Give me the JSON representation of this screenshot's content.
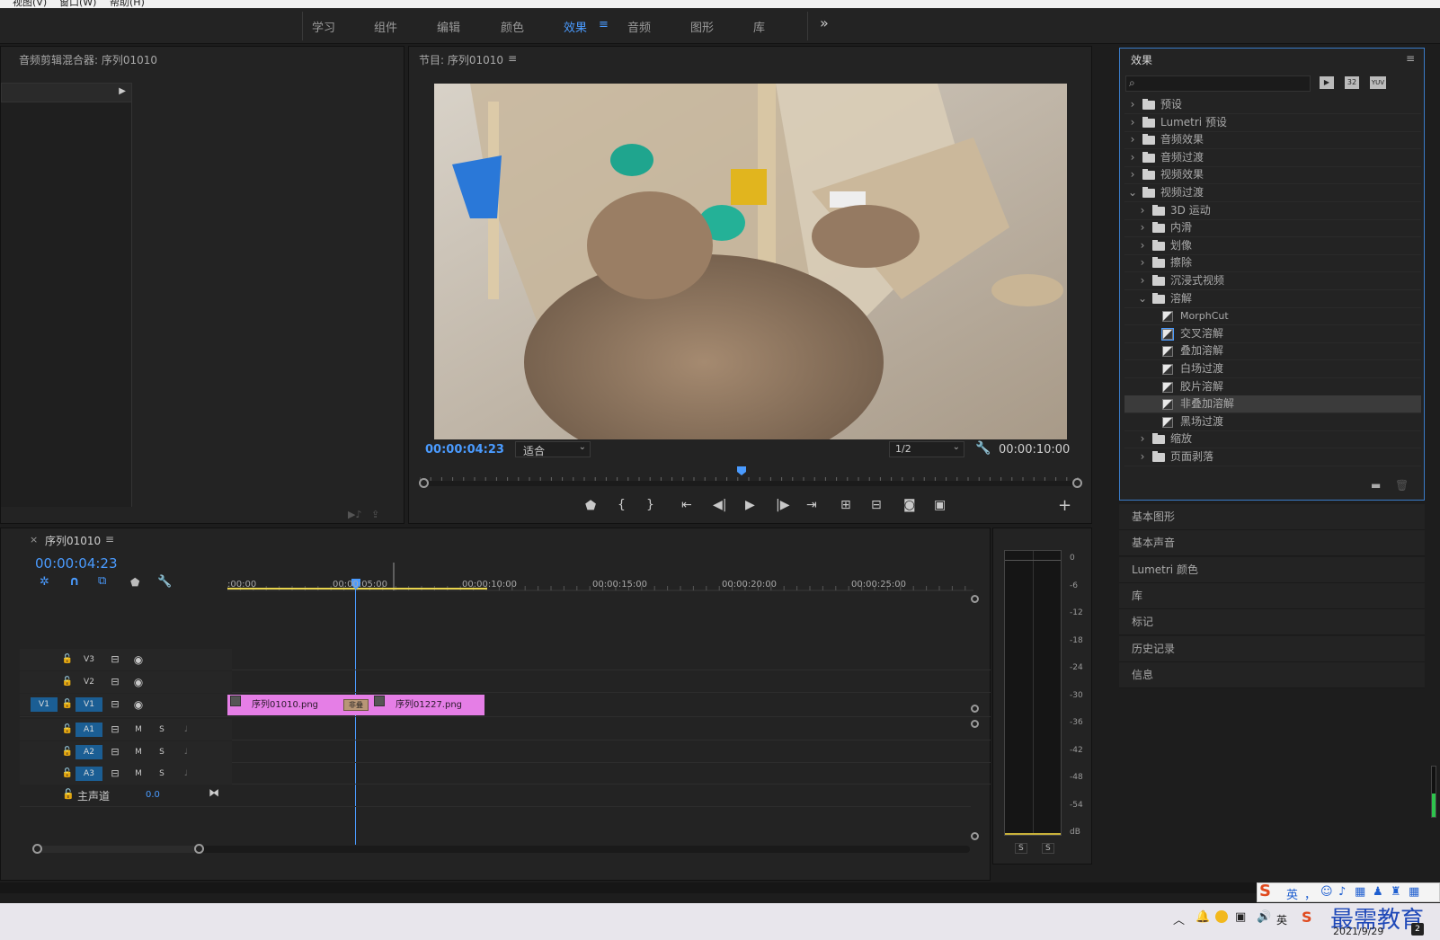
{
  "menubar": {
    "items": [
      "视图(V)",
      "窗口(W)",
      "帮助(H)"
    ]
  },
  "workspace": {
    "tabs": [
      "学习",
      "组件",
      "编辑",
      "颜色",
      "效果",
      "音频",
      "图形",
      "库"
    ],
    "active_tab": "效果",
    "menu_glyph": "≡",
    "overflow_glyph": "»"
  },
  "audio_mixer": {
    "title": "音频剪辑混合器: 序列01010"
  },
  "program_monitor": {
    "title": "节目: 序列01010",
    "menu_glyph": "≡",
    "timecode_current": "00:00:04:23",
    "fit_label": "适合",
    "resolution_label": "1/2",
    "timecode_duration": "00:00:10:00"
  },
  "effects_panel": {
    "title": "效果",
    "menu_glyph": "≡",
    "search_placeholder": "",
    "filter_badges": [
      "32",
      "YUV"
    ],
    "tree": [
      {
        "label": "预设",
        "level": 0,
        "type": "preset",
        "expanded": false
      },
      {
        "label": "Lumetri 预设",
        "level": 0,
        "type": "preset",
        "expanded": false
      },
      {
        "label": "音频效果",
        "level": 0,
        "type": "folder",
        "expanded": false
      },
      {
        "label": "音频过渡",
        "level": 0,
        "type": "folder",
        "expanded": false
      },
      {
        "label": "视频效果",
        "level": 0,
        "type": "folder",
        "expanded": false
      },
      {
        "label": "视频过渡",
        "level": 0,
        "type": "folder",
        "expanded": true
      },
      {
        "label": "3D 运动",
        "level": 1,
        "type": "folder",
        "expanded": false
      },
      {
        "label": "内滑",
        "level": 1,
        "type": "folder",
        "expanded": false
      },
      {
        "label": "划像",
        "level": 1,
        "type": "folder",
        "expanded": false
      },
      {
        "label": "擦除",
        "level": 1,
        "type": "folder",
        "expanded": false
      },
      {
        "label": "沉浸式视频",
        "level": 1,
        "type": "folder",
        "expanded": false
      },
      {
        "label": "溶解",
        "level": 1,
        "type": "folder",
        "expanded": true
      },
      {
        "label": "MorphCut",
        "level": 2,
        "type": "transition"
      },
      {
        "label": "交叉溶解",
        "level": 2,
        "type": "transition",
        "default": true
      },
      {
        "label": "叠加溶解",
        "level": 2,
        "type": "transition"
      },
      {
        "label": "白场过渡",
        "level": 2,
        "type": "transition"
      },
      {
        "label": "胶片溶解",
        "level": 2,
        "type": "transition"
      },
      {
        "label": "非叠加溶解",
        "level": 2,
        "type": "transition",
        "selected": true
      },
      {
        "label": "黑场过渡",
        "level": 2,
        "type": "transition"
      },
      {
        "label": "缩放",
        "level": 1,
        "type": "folder",
        "expanded": false
      },
      {
        "label": "页面剥落",
        "level": 1,
        "type": "folder",
        "expanded": false
      }
    ]
  },
  "side_panels": [
    "基本图形",
    "基本声音",
    "Lumetri 颜色",
    "库",
    "标记",
    "历史记录",
    "信息"
  ],
  "timeline": {
    "close_glyph": "×",
    "title": "序列01010",
    "menu_glyph": "≡",
    "timecode": "00:00:04:23",
    "ruler_labels": [
      ":00:00",
      "00:00:05:00",
      "00:00:10:00",
      "00:00:15:00",
      "00:00:20:00",
      "00:00:25:00"
    ],
    "tracks": [
      {
        "name": "V3",
        "kind": "video"
      },
      {
        "name": "V2",
        "kind": "video"
      },
      {
        "name": "V1",
        "kind": "video",
        "source": "V1"
      },
      {
        "name": "A1",
        "kind": "audio",
        "m": "M",
        "s": "S"
      },
      {
        "name": "A2",
        "kind": "audio",
        "m": "M",
        "s": "S"
      },
      {
        "name": "A3",
        "kind": "audio",
        "m": "M",
        "s": "S"
      }
    ],
    "master": {
      "label": "主声道",
      "value": "0.0"
    },
    "clips": [
      {
        "label": "序列01010.png",
        "color": "#e57ee6"
      },
      {
        "label": "序列01227.png",
        "color": "#e57ee6"
      }
    ],
    "transition_label": "非叠"
  },
  "audio_meter": {
    "scale": [
      "0",
      "-6",
      "-12",
      "-18",
      "-24",
      "-30",
      "-36",
      "-42",
      "-48",
      "-54",
      "dB"
    ],
    "solo_buttons": [
      "S",
      "S"
    ]
  },
  "taskbar": {
    "ime_items": [
      "英",
      "，",
      "☺",
      "🎤",
      "▦",
      "👤",
      "👕",
      "▦"
    ],
    "tray_ime": "英",
    "date": "2021/9/29",
    "badge": "2",
    "watermark": "最需教育"
  },
  "colors": {
    "accent": "#4a9bff",
    "clip": "#e57ee6",
    "track_blue": "#1b5e94",
    "in_out_bar": "#e8d44d"
  }
}
